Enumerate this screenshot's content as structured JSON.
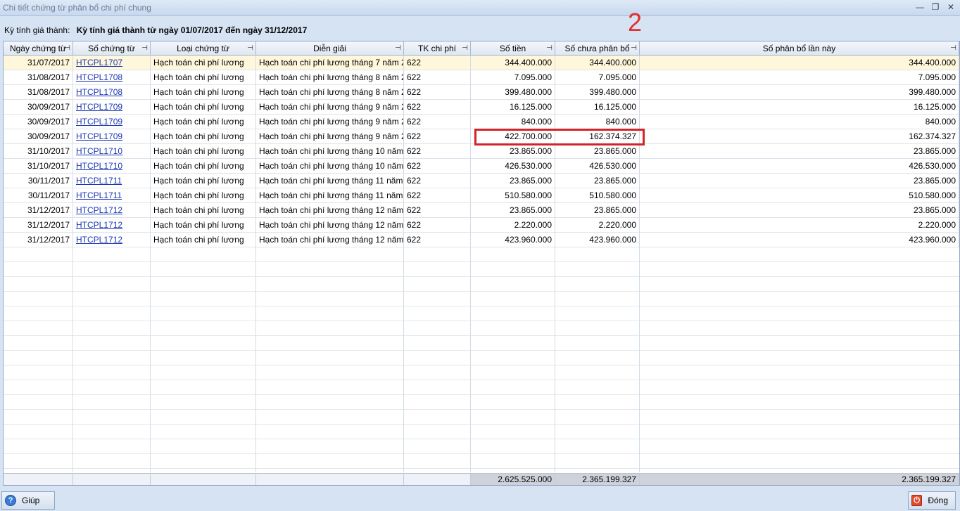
{
  "window": {
    "title": "Chi tiết chứng từ phân bổ chi phí chung",
    "minimize_icon": "minimize-icon",
    "restore_icon": "restore-icon",
    "close_icon": "close-icon"
  },
  "period": {
    "label": "Kỳ tính giá thành:",
    "value": "Kỳ tính giá thành từ ngày 01/07/2017 đến ngày 31/12/2017"
  },
  "annotation_number": "2",
  "columns": [
    {
      "label": "Ngày chứng từ"
    },
    {
      "label": "Số chứng từ"
    },
    {
      "label": "Loại chứng từ"
    },
    {
      "label": "Diễn giải"
    },
    {
      "label": "TK chi phí"
    },
    {
      "label": "Số tiền"
    },
    {
      "label": "Số chưa phân bổ"
    },
    {
      "label": "Số phân bổ lần này"
    }
  ],
  "rows": [
    {
      "date": "31/07/2017",
      "doc_no": "HTCPL1707",
      "doc_type": "Hạch toán chi phí lương",
      "desc": "Hạch toán chi phí lương tháng 7 năm 20",
      "account": "622",
      "amount": "344.400.000",
      "unallocated": "344.400.000",
      "allocated": "344.400.000",
      "selected": true
    },
    {
      "date": "31/08/2017",
      "doc_no": "HTCPL1708",
      "doc_type": "Hạch toán chi phí lương",
      "desc": "Hạch toán chi phí lương tháng 8 năm 20",
      "account": "622",
      "amount": "7.095.000",
      "unallocated": "7.095.000",
      "allocated": "7.095.000"
    },
    {
      "date": "31/08/2017",
      "doc_no": "HTCPL1708",
      "doc_type": "Hạch toán chi phí lương",
      "desc": "Hạch toán chi phí lương tháng 8 năm 20",
      "account": "622",
      "amount": "399.480.000",
      "unallocated": "399.480.000",
      "allocated": "399.480.000"
    },
    {
      "date": "30/09/2017",
      "doc_no": "HTCPL1709",
      "doc_type": "Hạch toán chi phí lương",
      "desc": "Hạch toán chi phí lương tháng 9 năm 20",
      "account": "622",
      "amount": "16.125.000",
      "unallocated": "16.125.000",
      "allocated": "16.125.000"
    },
    {
      "date": "30/09/2017",
      "doc_no": "HTCPL1709",
      "doc_type": "Hạch toán chi phí lương",
      "desc": "Hạch toán chi phí lương tháng 9 năm 20",
      "account": "622",
      "amount": "840.000",
      "unallocated": "840.000",
      "allocated": "840.000"
    },
    {
      "date": "30/09/2017",
      "doc_no": "HTCPL1709",
      "doc_type": "Hạch toán chi phí lương",
      "desc": "Hạch toán chi phí lương tháng 9 năm 20",
      "account": "622",
      "amount": "422.700.000",
      "unallocated": "162.374.327",
      "allocated": "162.374.327"
    },
    {
      "date": "31/10/2017",
      "doc_no": "HTCPL1710",
      "doc_type": "Hạch toán chi phí lương",
      "desc": "Hạch toán chi phí lương tháng 10 năm 2",
      "account": "622",
      "amount": "23.865.000",
      "unallocated": "23.865.000",
      "allocated": "23.865.000"
    },
    {
      "date": "31/10/2017",
      "doc_no": "HTCPL1710",
      "doc_type": "Hạch toán chi phí lương",
      "desc": "Hạch toán chi phí lương tháng 10 năm 2",
      "account": "622",
      "amount": "426.530.000",
      "unallocated": "426.530.000",
      "allocated": "426.530.000"
    },
    {
      "date": "30/11/2017",
      "doc_no": "HTCPL1711",
      "doc_type": "Hạch toán chi phí lương",
      "desc": "Hạch toán chi phí lương tháng 11 năm 2",
      "account": "622",
      "amount": "23.865.000",
      "unallocated": "23.865.000",
      "allocated": "23.865.000"
    },
    {
      "date": "30/11/2017",
      "doc_no": "HTCPL1711",
      "doc_type": "Hạch toán chi phí lương",
      "desc": "Hạch toán chi phí lương tháng 11 năm 2",
      "account": "622",
      "amount": "510.580.000",
      "unallocated": "510.580.000",
      "allocated": "510.580.000"
    },
    {
      "date": "31/12/2017",
      "doc_no": "HTCPL1712",
      "doc_type": "Hạch toán chi phí lương",
      "desc": "Hạch toán chi phí lương tháng 12 năm 2",
      "account": "622",
      "amount": "23.865.000",
      "unallocated": "23.865.000",
      "allocated": "23.865.000"
    },
    {
      "date": "31/12/2017",
      "doc_no": "HTCPL1712",
      "doc_type": "Hạch toán chi phí lương",
      "desc": "Hạch toán chi phí lương tháng 12 năm 2",
      "account": "622",
      "amount": "2.220.000",
      "unallocated": "2.220.000",
      "allocated": "2.220.000"
    },
    {
      "date": "31/12/2017",
      "doc_no": "HTCPL1712",
      "doc_type": "Hạch toán chi phí lương",
      "desc": "Hạch toán chi phí lương tháng 12 năm 2",
      "account": "622",
      "amount": "423.960.000",
      "unallocated": "423.960.000",
      "allocated": "423.960.000"
    }
  ],
  "totals": {
    "amount": "2.625.525.000",
    "unallocated": "2.365.199.327",
    "allocated": "2.365.199.327"
  },
  "buttons": {
    "help_label": "Giúp",
    "close_label": "Đóng"
  },
  "colors": {
    "highlight_box": "#d2232a",
    "selected_row": "#fff7dc",
    "link": "#1a36b5"
  }
}
